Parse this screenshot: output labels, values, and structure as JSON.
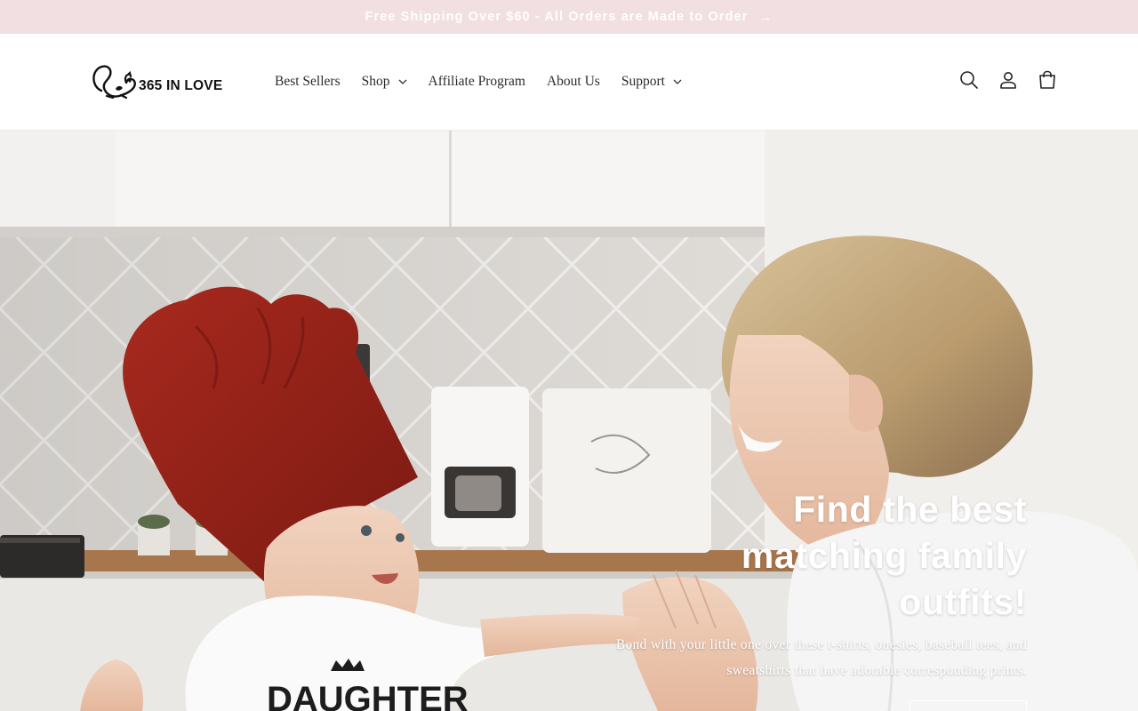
{
  "announcement": {
    "text": "Free Shipping Over $60 - All Orders are Made to Order",
    "arrow": "→",
    "background": "#f2dfe2"
  },
  "header": {
    "logo_text": "365 IN LOVE",
    "nav": [
      {
        "label": "Best Sellers",
        "has_dropdown": false
      },
      {
        "label": "Shop",
        "has_dropdown": true
      },
      {
        "label": "Affiliate Program",
        "has_dropdown": false
      },
      {
        "label": "About Us",
        "has_dropdown": false
      },
      {
        "label": "Support",
        "has_dropdown": true
      }
    ],
    "icons": [
      "search-icon",
      "account-icon",
      "cart-icon"
    ]
  },
  "hero": {
    "title": "Find the best matching family outfits!",
    "subtitle": "Bond with your little one over these t-shirts, onesies, baseball tees, and sweatshirts that have adorable corresponding prints.",
    "baby_shirt_text": "DAUGHTER"
  }
}
